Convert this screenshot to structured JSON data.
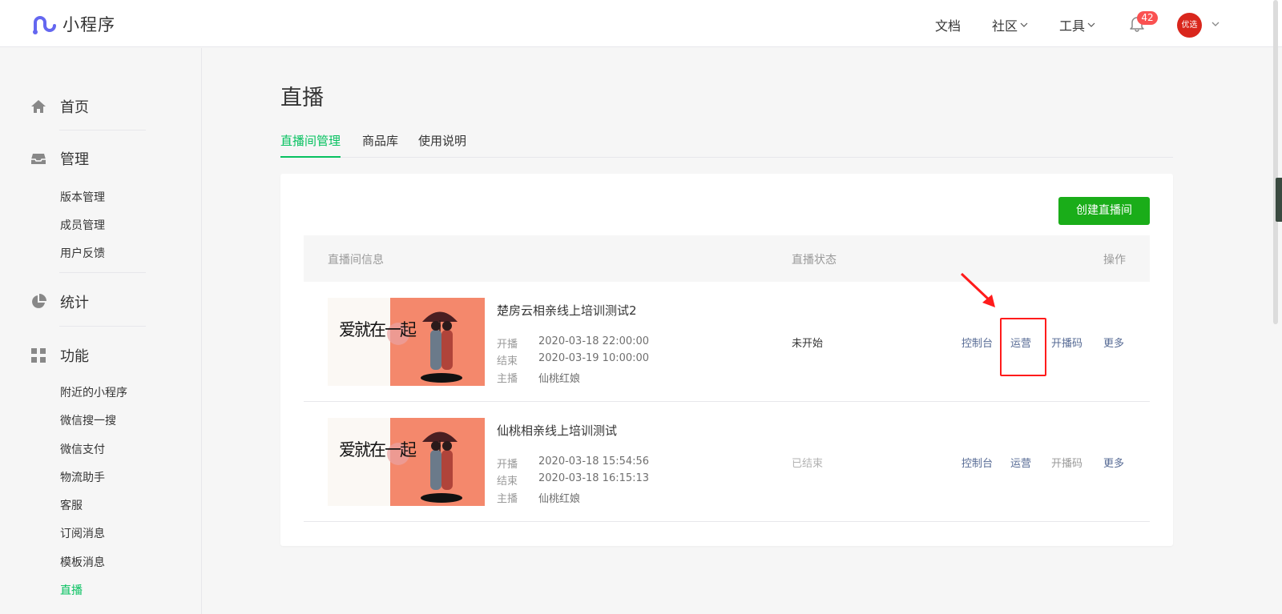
{
  "brand": {
    "name": "小程序",
    "accent": "#07c160",
    "logo_color": "#6467f0"
  },
  "topnav": {
    "docs": "文档",
    "community": "社区",
    "tools": "工具",
    "notification_count": "42",
    "avatar_text": "优选"
  },
  "sidebar": {
    "sections": [
      {
        "title": "首页",
        "icon": "home-icon"
      },
      {
        "title": "管理",
        "icon": "inbox-icon",
        "items": [
          "版本管理",
          "成员管理",
          "用户反馈"
        ]
      },
      {
        "title": "统计",
        "icon": "pie-chart-icon"
      },
      {
        "title": "功能",
        "icon": "grid-icon",
        "items": [
          "附近的小程序",
          "微信搜一搜",
          "微信支付",
          "物流助手",
          "客服",
          "订阅消息",
          "模板消息",
          "直播"
        ]
      }
    ],
    "active_item": "直播"
  },
  "page": {
    "title": "直播",
    "tabs": [
      "直播间管理",
      "商品库",
      "使用说明"
    ],
    "active_tab": "直播间管理",
    "create_button": "创建直播间"
  },
  "table": {
    "headers": {
      "info": "直播间信息",
      "status": "直播状态",
      "ops": "操作"
    },
    "labels": {
      "start": "开播",
      "end": "结束",
      "host": "主播"
    },
    "rows": [
      {
        "title": "楚房云相亲线上培训测试2",
        "start": "2020-03-18 22:00:00",
        "end": "2020-03-19 10:00:00",
        "host": "仙桃红娘",
        "status": "未开始",
        "ops": [
          "控制台",
          "运营",
          "开播码",
          "更多"
        ],
        "thumb_text": "爱就在一起"
      },
      {
        "title": "仙桃相亲线上培训测试",
        "start": "2020-03-18 15:54:56",
        "end": "2020-03-18 16:15:13",
        "host": "仙桃红娘",
        "status": "已结束",
        "ops": [
          "控制台",
          "运营",
          "开播码",
          "更多"
        ],
        "thumb_text": "爱就在一起"
      }
    ]
  }
}
